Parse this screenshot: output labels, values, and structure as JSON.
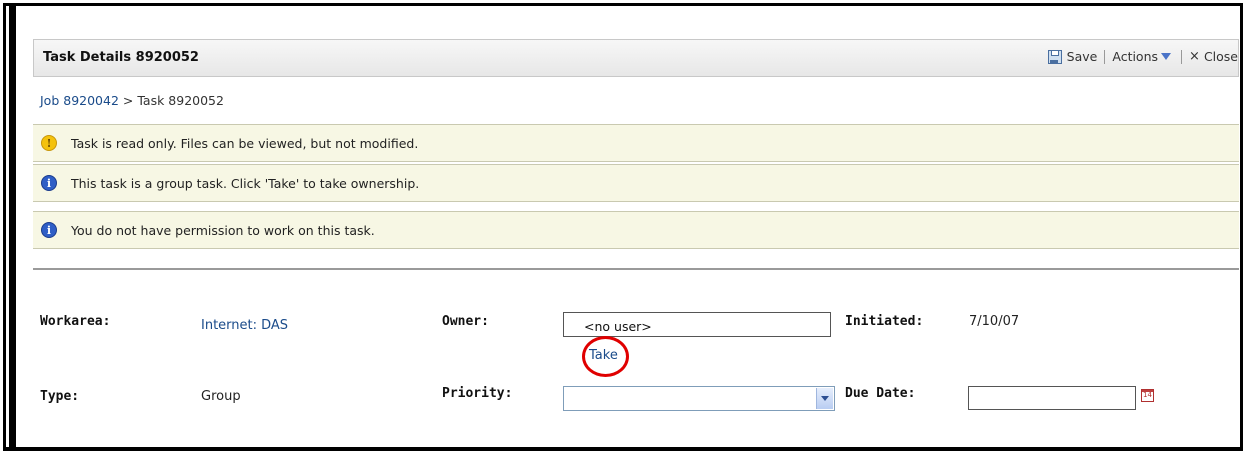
{
  "header": {
    "title": "Task Details 8920052",
    "save_label": "Save",
    "actions_label": "Actions",
    "close_label": "Close"
  },
  "breadcrumb": {
    "job_link": "Job 8920042",
    "separator": " > ",
    "current": "Task 8920052"
  },
  "messages": [
    {
      "type": "warning",
      "icon": "warning-icon",
      "text": "Task is read only. Files can be viewed, but not modified."
    },
    {
      "type": "info",
      "icon": "info-icon",
      "text": "This task is a group task. Click 'Take' to take ownership."
    },
    {
      "type": "info",
      "icon": "info-icon",
      "text": "You do not have permission to work on this task."
    }
  ],
  "fields": {
    "workarea_label": "Workarea:",
    "workarea_value": "Internet: DAS",
    "type_label": "Type:",
    "type_value": "Group",
    "owner_label": "Owner:",
    "owner_value": "<no user>",
    "take_link": "Take",
    "priority_label": "Priority:",
    "priority_value": "",
    "initiated_label": "Initiated:",
    "initiated_value": "7/10/07",
    "due_date_label": "Due Date:",
    "due_date_value": "",
    "calendar_day": "14"
  },
  "colors": {
    "highlight_circle": "#e00000",
    "link": "#1a4b8a",
    "message_bg": "#f7f7e4"
  }
}
